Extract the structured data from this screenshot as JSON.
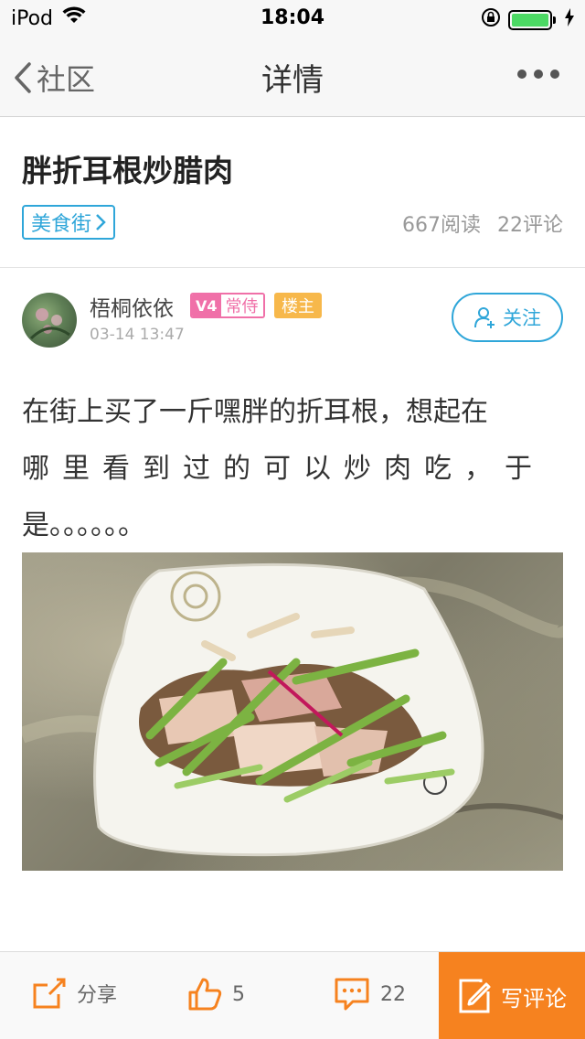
{
  "status_bar": {
    "carrier": "iPod",
    "time": "18:04"
  },
  "nav": {
    "back_label": "社区",
    "title": "详情"
  },
  "post": {
    "title": "胖折耳根炒腊肉",
    "category": "美食街",
    "reads": "667阅读",
    "comments": "22评论",
    "body_lines": [
      "在街上买了一斤嘿胖的折耳根，想起在",
      "哪里看到过的可以炒肉吃，于",
      "是。。。。。。"
    ]
  },
  "author": {
    "name": "梧桐依依",
    "level_badge": "V4",
    "rank": "常侍",
    "owner_tag": "楼主",
    "time": "03-14 13:47",
    "follow_label": "关注"
  },
  "toolbar": {
    "share_label": "分享",
    "like_count": "5",
    "comment_count": "22",
    "write_label": "写评论"
  },
  "colors": {
    "accent_blue": "#2fa6d9",
    "accent_orange": "#f6821f",
    "badge_pink": "#f070a8",
    "badge_gold": "#f7b84b",
    "battery_green": "#4cd964"
  },
  "icons": {
    "wifi": "wifi-icon",
    "lock": "rotation-lock-icon",
    "battery": "battery-icon",
    "charging": "charging-bolt-icon",
    "back": "chevron-left-icon",
    "more": "more-dots-icon",
    "follow": "add-user-icon",
    "share": "share-icon",
    "like": "thumbs-up-icon",
    "comment": "comment-bubble-icon",
    "write": "edit-icon"
  }
}
